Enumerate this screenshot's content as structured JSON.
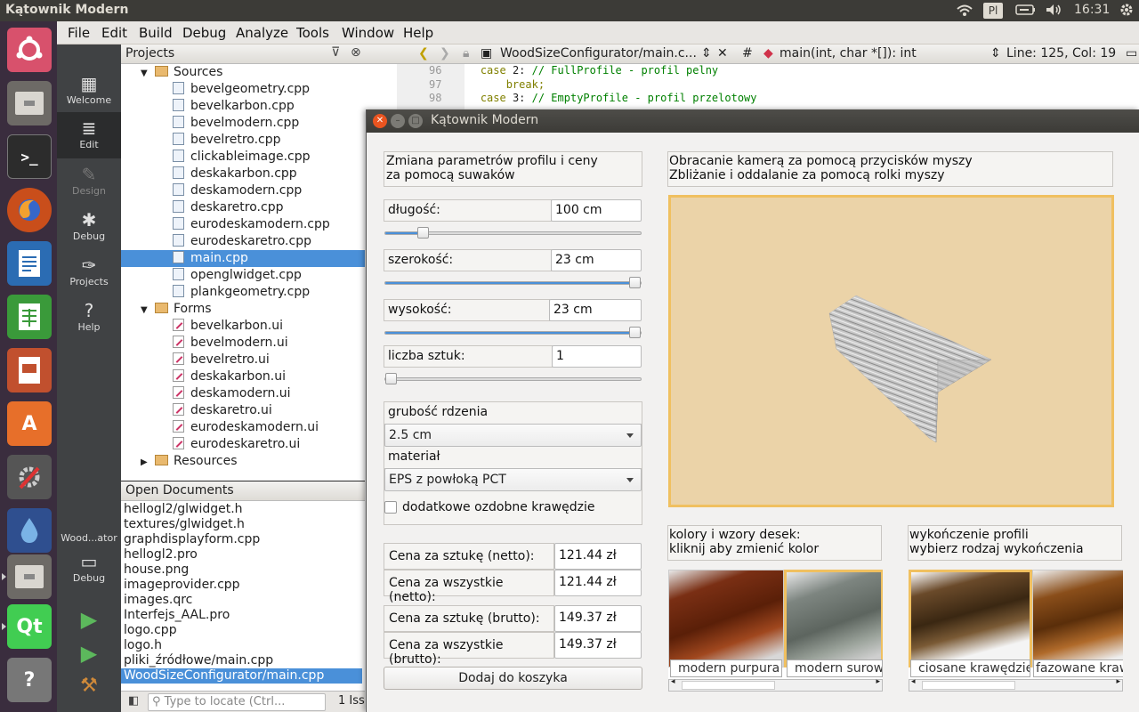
{
  "top_panel": {
    "title": "Kątownik Modern",
    "kb_layout": "Pl",
    "time": "16:31"
  },
  "launcher": {
    "items": [
      "ubuntu-dash",
      "files",
      "terminal",
      "firefox",
      "writer",
      "calc",
      "impress",
      "software-center",
      "system-settings",
      "drop",
      "files-2",
      "qt-creator",
      "help"
    ]
  },
  "menubar": {
    "items": [
      "File",
      "Edit",
      "Build",
      "Debug",
      "Analyze",
      "Tools",
      "Window",
      "Help"
    ]
  },
  "modes": {
    "welcome": "Welcome",
    "edit": "Edit",
    "design": "Design",
    "debug": "Debug",
    "projects": "Projects",
    "help": "Help",
    "target_name": "Wood...ator",
    "target_mode": "Debug"
  },
  "projects": {
    "header": "Projects",
    "sources_label": "Sources",
    "sources": [
      "bevelgeometry.cpp",
      "bevelkarbon.cpp",
      "bevelmodern.cpp",
      "bevelretro.cpp",
      "clickableimage.cpp",
      "deskakarbon.cpp",
      "deskamodern.cpp",
      "deskaretro.cpp",
      "eurodeskamodern.cpp",
      "eurodeskaretro.cpp",
      "main.cpp",
      "openglwidget.cpp",
      "plankgeometry.cpp"
    ],
    "forms_label": "Forms",
    "forms": [
      "bevelkarbon.ui",
      "bevelmodern.ui",
      "bevelretro.ui",
      "deskakarbon.ui",
      "deskamodern.ui",
      "deskaretro.ui",
      "eurodeskamodern.ui",
      "eurodeskaretro.ui"
    ],
    "resources_label": "Resources"
  },
  "open_documents": {
    "header": "Open Documents",
    "items": [
      "hellogl2/glwidget.h",
      "textures/glwidget.h",
      "graphdisplayform.cpp",
      "hellogl2.pro",
      "house.png",
      "imageprovider.cpp",
      "images.qrc",
      "Interfejs_AAL.pro",
      "logo.cpp",
      "logo.h",
      "pliki_źródłowe/main.cpp",
      "WoodSizeConfigurator/main.cpp"
    ]
  },
  "locator": {
    "placeholder": "Type to locate (Ctrl...",
    "issues": "1  Iss"
  },
  "editor": {
    "file": "WoodSizeConfigurator/main.c...",
    "symbol": "main(int, char *[]): int",
    "position": "Line: 125, Col: 19",
    "lines": [
      {
        "n": "96",
        "kw": "case",
        "rest": " 2: ",
        "comment": "// FullProfile - profil pelny"
      },
      {
        "n": "97",
        "text": "    break;"
      },
      {
        "n": "98",
        "kw": "case",
        "rest": " 3: ",
        "comment": "// EmptyProfile - profil przelotowy"
      }
    ]
  },
  "dialog": {
    "title": "Kątownik Modern",
    "params_info": [
      "Zmiana parametrów profilu i ceny",
      "za pomocą suwaków"
    ],
    "length": {
      "label": "długość:",
      "value": "100 cm",
      "level": 0.13
    },
    "width": {
      "label": "szerokość:",
      "value": "23 cm",
      "level": 1.0
    },
    "height": {
      "label": "wysokość:",
      "value": "23 cm",
      "level": 1.0
    },
    "quantity": {
      "label": "liczba sztuk:",
      "value": "1",
      "level": 0.0
    },
    "core_label": "grubość rdzenia",
    "core_value": "2.5 cm",
    "material_label": "materiał",
    "material_value": "EPS z powłoką PCT",
    "decor_label": "dodatkowe ozdobne krawędzie",
    "price_unit_net": {
      "label": "Cena za sztukę (netto):",
      "value": "121.44 zł"
    },
    "price_all_net": {
      "label": "Cena za wszystkie (netto):",
      "value": "121.44 zł"
    },
    "price_unit_gross": {
      "label": "Cena za sztukę (brutto):",
      "value": "149.37 zł"
    },
    "price_all_gross": {
      "label": "Cena za wszystkie (brutto):",
      "value": "149.37 zł"
    },
    "add_button": "Dodaj do koszyka",
    "camera_info": [
      "Obracanie kamerą za pomocą przycisków myszy",
      "Zbliżanie i oddalanie za pomocą rolki myszy"
    ],
    "colors_info": [
      "kolory i wzory desek:",
      "kliknij aby zmienić kolor"
    ],
    "finish_info": [
      "wykończenie profili",
      "wybierz rodzaj wykończenia"
    ],
    "colors": [
      "modern purpura",
      "modern surowy"
    ],
    "finishes": [
      "ciosane krawędzie",
      "fazowane krawędzie"
    ],
    "accent": "#f0c060"
  }
}
